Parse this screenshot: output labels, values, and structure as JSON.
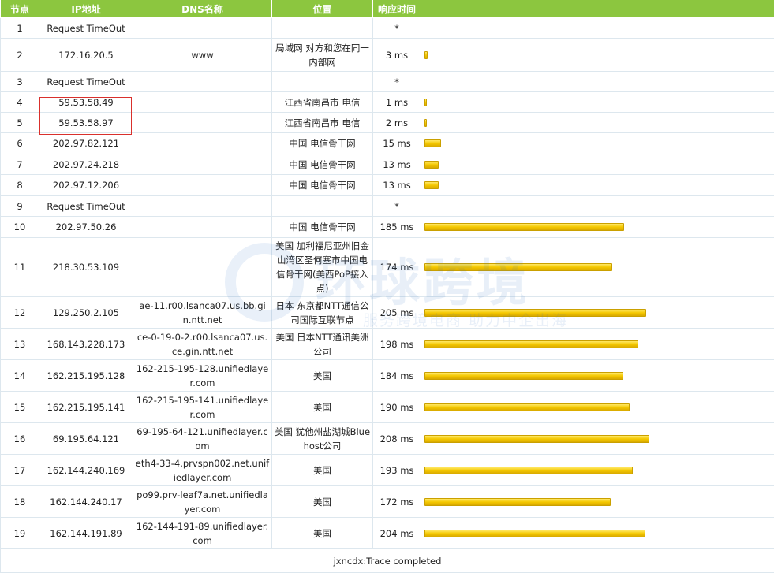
{
  "headers": [
    "节点",
    "IP地址",
    "DNS名称",
    "位置",
    "响应时间",
    ""
  ],
  "hops": [
    {
      "no": "1",
      "ip": "Request TimeOut",
      "dns": "",
      "loc": "",
      "time": "*",
      "ms": 0
    },
    {
      "no": "2",
      "ip": "172.16.20.5",
      "dns": "www",
      "loc": "局域网 对方和您在同一内部网",
      "time": "3 ms",
      "ms": 3
    },
    {
      "no": "3",
      "ip": "Request TimeOut",
      "dns": "",
      "loc": "",
      "time": "*",
      "ms": 0
    },
    {
      "no": "4",
      "ip": "59.53.58.49",
      "dns": "",
      "loc": "江西省南昌市 电信",
      "time": "1 ms",
      "ms": 1
    },
    {
      "no": "5",
      "ip": "59.53.58.97",
      "dns": "",
      "loc": "江西省南昌市 电信",
      "time": "2 ms",
      "ms": 2
    },
    {
      "no": "6",
      "ip": "202.97.82.121",
      "dns": "",
      "loc": "中国 电信骨干网",
      "time": "15 ms",
      "ms": 15
    },
    {
      "no": "7",
      "ip": "202.97.24.218",
      "dns": "",
      "loc": "中国 电信骨干网",
      "time": "13 ms",
      "ms": 13
    },
    {
      "no": "8",
      "ip": "202.97.12.206",
      "dns": "",
      "loc": "中国 电信骨干网",
      "time": "13 ms",
      "ms": 13
    },
    {
      "no": "9",
      "ip": "Request TimeOut",
      "dns": "",
      "loc": "",
      "time": "*",
      "ms": 0
    },
    {
      "no": "10",
      "ip": "202.97.50.26",
      "dns": "",
      "loc": "中国 电信骨干网",
      "time": "185 ms",
      "ms": 185
    },
    {
      "no": "11",
      "ip": "218.30.53.109",
      "dns": "",
      "loc": "美国 加利福尼亚州旧金山湾区圣何塞市中国电信骨干网(美西PoP接入点)",
      "time": "174 ms",
      "ms": 174
    },
    {
      "no": "12",
      "ip": "129.250.2.105",
      "dns": "ae-11.r00.lsanca07.us.bb.gin.ntt.net",
      "loc": "日本 东京都NTT通信公司国际互联节点",
      "time": "205 ms",
      "ms": 205
    },
    {
      "no": "13",
      "ip": "168.143.228.173",
      "dns": "ce-0-19-0-2.r00.lsanca07.us.ce.gin.ntt.net",
      "loc": "美国 日本NTT通讯美洲公司",
      "time": "198 ms",
      "ms": 198
    },
    {
      "no": "14",
      "ip": "162.215.195.128",
      "dns": "162-215-195-128.unifiedlayer.com",
      "loc": "美国",
      "time": "184 ms",
      "ms": 184
    },
    {
      "no": "15",
      "ip": "162.215.195.141",
      "dns": "162-215-195-141.unifiedlayer.com",
      "loc": "美国",
      "time": "190 ms",
      "ms": 190
    },
    {
      "no": "16",
      "ip": "69.195.64.121",
      "dns": "69-195-64-121.unifiedlayer.com",
      "loc": "美国 犹他州盐湖城Bluehost公司",
      "time": "208 ms",
      "ms": 208
    },
    {
      "no": "17",
      "ip": "162.144.240.169",
      "dns": "eth4-33-4.prvspn002.net.unifiedlayer.com",
      "loc": "美国",
      "time": "193 ms",
      "ms": 193
    },
    {
      "no": "18",
      "ip": "162.144.240.17",
      "dns": "po99.prv-leaf7a.net.unifiedlayer.com",
      "loc": "美国",
      "time": "172 ms",
      "ms": 172
    },
    {
      "no": "19",
      "ip": "162.144.191.89",
      "dns": "162-144-191-89.unifiedlayer.com",
      "loc": "美国",
      "time": "204 ms",
      "ms": 204
    }
  ],
  "footer": "jxncdx:Trace completed",
  "colors": {
    "header_bg": "#8cc63f",
    "bar": "#f4c800",
    "highlight": "#d9302c",
    "grid": "#dde7ee"
  },
  "watermark": {
    "title": "环球跨境",
    "subtitle": "服务跨境电商 助力中企出海"
  }
}
